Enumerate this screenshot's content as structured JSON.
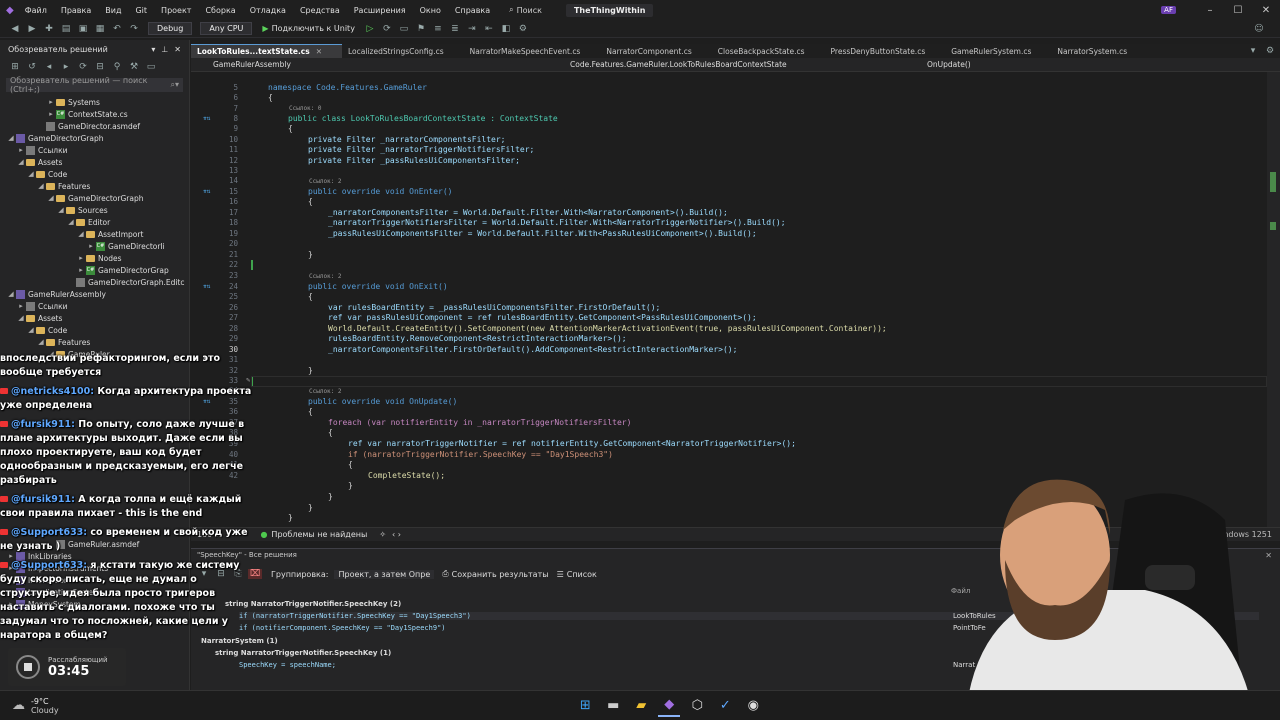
{
  "titlebar": {
    "menus": [
      "Файл",
      "Правка",
      "Вид",
      "Git",
      "Проект",
      "Сборка",
      "Отладка",
      "Средства",
      "Расширения",
      "Окно",
      "Справка"
    ],
    "search": "Поиск",
    "solution": "TheThingWithin",
    "profile": "AF"
  },
  "toolbar": {
    "config": "Debug",
    "platform": "Any CPU",
    "run_label": "Подключить к Unity"
  },
  "solution_explorer": {
    "title": "Обозреватель решений",
    "search_placeholder": "Обозреватель решений — поиск (Ctrl+;)",
    "items": [
      {
        "label": "Systems",
        "indent": 4,
        "kind": "folder",
        "arrow": "▸"
      },
      {
        "label": "ContextState.cs",
        "indent": 4,
        "kind": "cs",
        "arrow": "▸"
      },
      {
        "label": "GameDirector.asmdef",
        "indent": 3,
        "kind": "file",
        "arrow": ""
      },
      {
        "label": "GameDirectorGraph",
        "indent": 0,
        "kind": "proj",
        "arrow": "◢"
      },
      {
        "label": "Ссылки",
        "indent": 1,
        "kind": "file",
        "arrow": "▸"
      },
      {
        "label": "Assets",
        "indent": 1,
        "kind": "folder",
        "arrow": "◢"
      },
      {
        "label": "Code",
        "indent": 2,
        "kind": "folder",
        "arrow": "◢"
      },
      {
        "label": "Features",
        "indent": 3,
        "kind": "folder",
        "arrow": "◢"
      },
      {
        "label": "GameDirectorGraph",
        "indent": 4,
        "kind": "folder",
        "arrow": "◢"
      },
      {
        "label": "Sources",
        "indent": 5,
        "kind": "folder",
        "arrow": "◢"
      },
      {
        "label": "Editor",
        "indent": 6,
        "kind": "folder",
        "arrow": "◢"
      },
      {
        "label": "AssetImport",
        "indent": 7,
        "kind": "folder",
        "arrow": "◢"
      },
      {
        "label": "GameDirectorIi",
        "indent": 8,
        "kind": "cs",
        "arrow": "▸"
      },
      {
        "label": "Nodes",
        "indent": 7,
        "kind": "folder",
        "arrow": "▸"
      },
      {
        "label": "GameDirectorGrap",
        "indent": 7,
        "kind": "cs",
        "arrow": "▸"
      },
      {
        "label": "GameDirectorGraph.Editc",
        "indent": 6,
        "kind": "file",
        "arrow": ""
      },
      {
        "label": "GameRulerAssembly",
        "indent": 0,
        "kind": "proj",
        "arrow": "◢"
      },
      {
        "label": "Ссылки",
        "indent": 1,
        "kind": "file",
        "arrow": "▸"
      },
      {
        "label": "Assets",
        "indent": 1,
        "kind": "folder",
        "arrow": "◢"
      },
      {
        "label": "Code",
        "indent": 2,
        "kind": "folder",
        "arrow": "◢"
      },
      {
        "label": "Features",
        "indent": 3,
        "kind": "folder",
        "arrow": "◢"
      },
      {
        "label": "GameRuler",
        "indent": 4,
        "kind": "folder",
        "arrow": "◢"
      }
    ],
    "bottom_items": [
      {
        "label": "GameRuler.asmdef",
        "indent": 4,
        "kind": "file",
        "arrow": ""
      },
      {
        "label": "InkLibraries",
        "indent": 0,
        "kind": "proj",
        "arrow": "▸"
      },
      {
        "label": "InspectorInstruments",
        "indent": 0,
        "kind": "proj",
        "arrow": "▸"
      },
      {
        "label": "Interaction",
        "indent": 0,
        "kind": "proj",
        "arrow": "▸"
      },
      {
        "label": "LocalizationSystem",
        "indent": 0,
        "kind": "proj",
        "arrow": "▸"
      },
      {
        "label": "MoneySystem",
        "indent": 0,
        "kind": "proj",
        "arrow": "▸"
      }
    ]
  },
  "tabs": [
    {
      "label": "LookToRules...textState.cs",
      "active": true
    },
    {
      "label": "LocalizedStringsConfig.cs",
      "active": false
    },
    {
      "label": "NarratorMakeSpeechEvent.cs",
      "active": false
    },
    {
      "label": "NarratorComponent.cs",
      "active": false
    },
    {
      "label": "CloseBackpackState.cs",
      "active": false
    },
    {
      "label": "PressDenyButtonState.cs",
      "active": false
    },
    {
      "label": "GameRulerSystem.cs",
      "active": false
    },
    {
      "label": "NarratorSystem.cs",
      "active": false
    }
  ],
  "navbar": {
    "project": "GameRulerAssembly",
    "type": "Code.Features.GameRuler.LookToRulesBoardContextState",
    "member": "OnUpdate()"
  },
  "code": {
    "refs_0": "Ссылок: 0",
    "refs_2": "Ссылок: 2",
    "line_numbers": [
      "5",
      "6",
      "7",
      "8",
      "9",
      "10",
      "11",
      "12",
      "13",
      "14",
      "15",
      "16",
      "17",
      "18",
      "19",
      "20",
      "21",
      "22",
      "23",
      "24",
      "25",
      "26",
      "27",
      "28",
      "29",
      "30",
      "31",
      "32",
      "33",
      "34",
      "35",
      "36",
      "37",
      "38",
      "39",
      "40",
      "41",
      "42"
    ],
    "l_ns": "namespace Code.Features.GameRuler",
    "l_cls": "public class LookToRulesBoardContextState : ContextState",
    "l_f1": "private Filter _narratorComponentsFilter;",
    "l_f2": "private Filter _narratorTriggerNotifiersFilter;",
    "l_f3": "private Filter _passRulesUiComponentsFilter;",
    "l_enter": "public override void OnEnter()",
    "l_e1": "_narratorComponentsFilter = World.Default.Filter.With<NarratorComponent>().Build();",
    "l_e2": "_narratorTriggerNotifiersFilter = World.Default.Filter.With<NarratorTriggerNotifier>().Build();",
    "l_e3": "_passRulesUiComponentsFilter = World.Default.Filter.With<PassRulesUiComponent>().Build();",
    "l_exit": "public override void OnExit()",
    "l_x1": "var rulesBoardEntity = _passRulesUiComponentsFilter.FirstOrDefault();",
    "l_x2": "ref var passRulesUiComponent = ref rulesBoardEntity.GetComponent<PassRulesUiComponent>();",
    "l_x3": "World.Default.CreateEntity().SetComponent(new AttentionMarkerActivationEvent(true, passRulesUiComponent.Container));",
    "l_x4": "rulesBoardEntity.RemoveComponent<RestrictInteractionMarker>();",
    "l_x5": "_narratorComponentsFilter.FirstOrDefault().AddComponent<RestrictInteractionMarker>();",
    "l_upd": "public override void OnUpdate()",
    "l_u1": "foreach (var notifierEntity in _narratorTriggerNotifiersFilter)",
    "l_u2": "ref var narratorTriggerNotifier = ref notifierEntity.GetComponent<NarratorTriggerNotifier>();",
    "l_u3": "if (narratorTriggerNotifier.SpeechKey == \"Day1Speech3\")",
    "l_u4": "CompleteState();",
    "open_brace": "{",
    "close_brace": "}"
  },
  "editor_status": {
    "zoom": "100 %",
    "problems": "Проблемы не найдены",
    "right": "Windows 1251"
  },
  "find_panel": {
    "title": "\"SpeechKey\" - Все решения",
    "group_label": "Группировка:",
    "group_value": "Проект, а затем Опре",
    "save_results": "Сохранить результаты",
    "list": "Список",
    "file_col": "Файл",
    "r1": "string NarratorTriggerNotifier.SpeechKey (2)",
    "r1a": "if (narratorTriggerNotifier.SpeechKey == \"Day1Speech3\")",
    "r1b": "if (notifierComponent.SpeechKey == \"Day1Speech9\")",
    "r2": "NarratorSystem (1)",
    "r2a": "string NarratorTriggerNotifier.SpeechKey (1)",
    "r2b": "SpeechKey = speechName;",
    "f1": "LookToRules",
    "f2": "PointToFe",
    "f3": "Narrat"
  },
  "chat": [
    {
      "user": "",
      "text": "впоследствии рефакторингом, если это вообще требуется"
    },
    {
      "user": "@netricks4100:",
      "text": "Когда архитектура проекта уже определена"
    },
    {
      "user": "@fursik911:",
      "text": "По опыту, соло даже лучше в плане архитектуры выходит. Даже если вы плохо проектируете, ваш код будет однообразным и предсказуемым, его легче разбирать"
    },
    {
      "user": "@fursik911:",
      "text": "А когда толпа и ещё каждый свои правила пихает - this is the end"
    },
    {
      "user": "@Support633:",
      "text": "со временем и свой код уже не узнать )"
    },
    {
      "user": "@Support633:",
      "text": "я кстати такую же систему буду скоро писать, еще не думал о структуре, идея была просто тригеров наставить с диалогами. похоже что ты задумал что то посложней, какие цели у наратора в общем?"
    }
  ],
  "timer": {
    "label": "Расслабляющий",
    "time": "03:45"
  },
  "weather": {
    "temp": "-9°C",
    "desc": "Cloudy"
  },
  "colors": {
    "accent": "#5b9bd5",
    "keyword": "#569cd6",
    "type": "#4ec9b0",
    "string": "#ce9178"
  }
}
